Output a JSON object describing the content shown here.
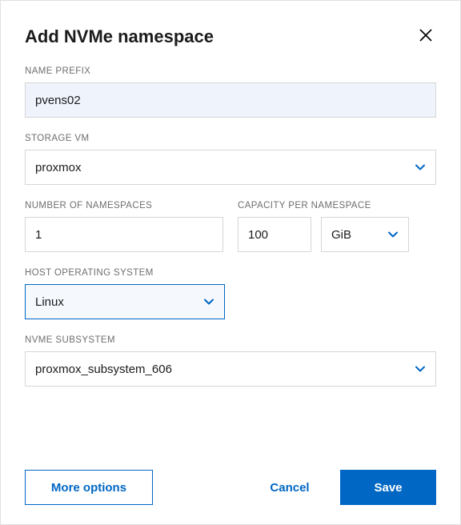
{
  "dialog": {
    "title": "Add NVMe namespace"
  },
  "fields": {
    "name_prefix": {
      "label": "NAME PREFIX",
      "value": "pvens02"
    },
    "storage_vm": {
      "label": "STORAGE VM",
      "value": "proxmox"
    },
    "num_ns": {
      "label": "NUMBER OF NAMESPACES",
      "value": "1"
    },
    "cap_ns": {
      "label": "CAPACITY PER NAMESPACE",
      "value": "100",
      "unit": "GiB"
    },
    "host_os": {
      "label": "HOST OPERATING SYSTEM",
      "value": "Linux"
    },
    "nvme_sub": {
      "label": "NVME SUBSYSTEM",
      "value": "proxmox_subsystem_606"
    }
  },
  "buttons": {
    "more": "More options",
    "cancel": "Cancel",
    "save": "Save"
  }
}
